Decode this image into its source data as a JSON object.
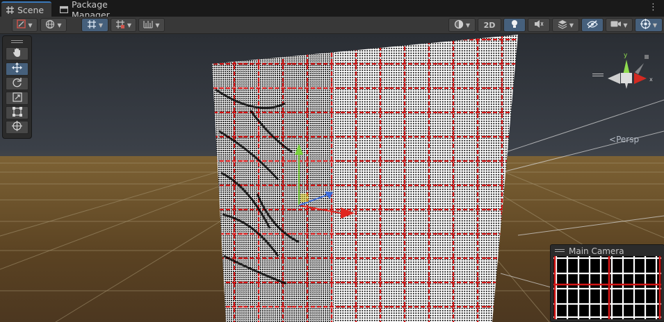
{
  "tabs": [
    {
      "label": "Scene",
      "icon": "grid-icon"
    },
    {
      "label": "Package Manager",
      "icon": "package-icon"
    }
  ],
  "window_menu_icon": "kebab-menu-icon",
  "toolbar": {
    "two_d_label": "2D",
    "left_groups": [
      "draw-mode-icon",
      "global-local-icon",
      "grid-snap-icon",
      "increment-snap-icon",
      "ruler-icon"
    ],
    "right_groups": [
      "shading-mode-icon",
      "lighting-icon",
      "audio-icon",
      "effects-icon",
      "hidden-objects-icon",
      "camera-icon",
      "gizmos-icon"
    ]
  },
  "tools": [
    "hand-icon",
    "move-icon",
    "rotate-icon",
    "scale-icon",
    "rect-icon",
    "transform-icon"
  ],
  "active_tool": "move-icon",
  "orientation_gizmo": {
    "projection_label": "Persp",
    "axes": [
      "y",
      "x"
    ]
  },
  "camera_preview": {
    "title": "Main Camera"
  },
  "colors": {
    "accent": "#3a79bb",
    "active_button": "#46607c",
    "toolbar": "#383838",
    "texture_grid": "#ffffff",
    "texture_red": "#d41414"
  }
}
